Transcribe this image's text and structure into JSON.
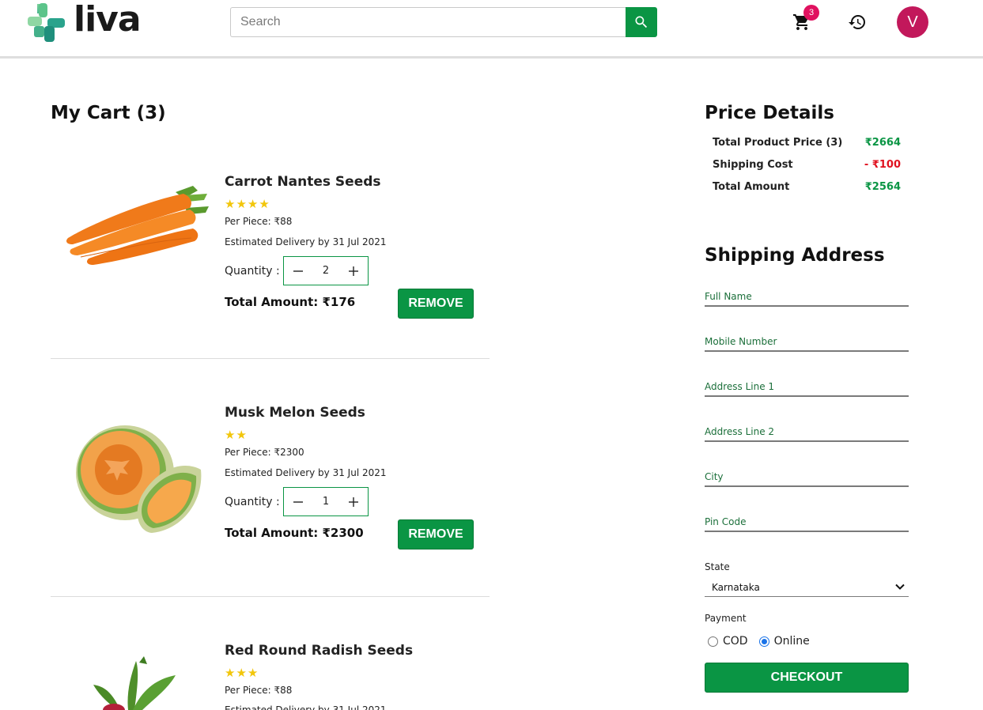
{
  "header": {
    "logo_text": "liva",
    "search_placeholder": "Search",
    "cart_count": "3",
    "avatar_initial": "V"
  },
  "cart": {
    "title": "My Cart (3)",
    "items": [
      {
        "name": "Carrot Nantes Seeds",
        "stars": "★★★★",
        "rating": 4,
        "per_piece": "Per Piece: ₹88",
        "delivery": "Estimated Delivery by 31 Jul 2021",
        "qty_label": "Quantity :",
        "quantity": "2",
        "total": "Total Amount: ₹176",
        "remove_label": "REMOVE"
      },
      {
        "name": "Musk Melon Seeds",
        "stars": "★★",
        "rating": 2,
        "per_piece": "Per Piece: ₹2300",
        "delivery": "Estimated Delivery by 31 Jul 2021",
        "qty_label": "Quantity :",
        "quantity": "1",
        "total": "Total Amount: ₹2300",
        "remove_label": "REMOVE"
      },
      {
        "name": "Red Round Radish Seeds",
        "stars": "★★★",
        "rating": 3,
        "per_piece": "Per Piece: ₹88",
        "delivery": "Estimated Delivery by 31 Jul 2021"
      }
    ]
  },
  "price_details": {
    "title": "Price Details",
    "rows": [
      {
        "label": "Total Product Price (3)",
        "value": "₹2664"
      },
      {
        "label": "Shipping Cost",
        "value": "- ₹100"
      },
      {
        "label": "Total Amount",
        "value": "₹2564"
      }
    ]
  },
  "shipping": {
    "title": "Shipping Address",
    "fields": {
      "full_name": "Full Name",
      "mobile": "Mobile Number",
      "address1": "Address Line 1",
      "address2": "Address Line 2",
      "city": "City",
      "pin": "Pin Code"
    },
    "state_label": "State",
    "state_value": "Karnataka",
    "payment_label": "Payment",
    "payment_options": [
      "COD",
      "Online"
    ],
    "payment_selected": "Online",
    "checkout_label": "CHECKOUT"
  },
  "colors": {
    "brand_green": "#0a9544",
    "badge_pink": "#e0115f",
    "avatar": "#c2185b",
    "star": "#f2c60b",
    "shipping_red": "#e0111f"
  },
  "icons": [
    "search-icon",
    "cart-icon",
    "history-icon",
    "chevron-down-icon",
    "minus-icon",
    "plus-icon"
  ]
}
